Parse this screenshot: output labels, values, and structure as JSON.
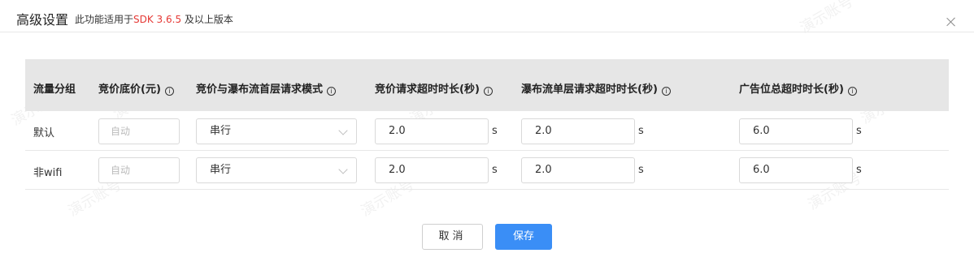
{
  "dialog": {
    "title": "高级设置",
    "subtitle_prefix": "此功能适用于",
    "subtitle_sdk": "SDK 3.6.5",
    "subtitle_suffix": " 及以上版本"
  },
  "table": {
    "headers": [
      "流量分组",
      "竞价底价(元)",
      "竞价与瀑布流首层请求模式",
      "竞价请求超时时长(秒)",
      "瀑布流单层请求超时时长(秒)",
      "广告位总超时时长(秒)"
    ],
    "info_icon": "ⓘ",
    "rows": [
      {
        "group": "默认",
        "floor_price_placeholder": "自动",
        "mode": "串行",
        "bid_timeout": "2.0",
        "waterfall_timeout": "2.0",
        "total_timeout": "6.0",
        "unit": "s"
      },
      {
        "group": "非wifi",
        "floor_price_placeholder": "自动",
        "mode": "串行",
        "bid_timeout": "2.0",
        "waterfall_timeout": "2.0",
        "total_timeout": "6.0",
        "unit": "s"
      }
    ]
  },
  "buttons": {
    "cancel": "取消",
    "save": "保存"
  },
  "watermark": "演示账号",
  "colors": {
    "primary": "#3a8ef6",
    "sdk_highlight": "#e53935",
    "header_bg": "#e6e6e6"
  }
}
